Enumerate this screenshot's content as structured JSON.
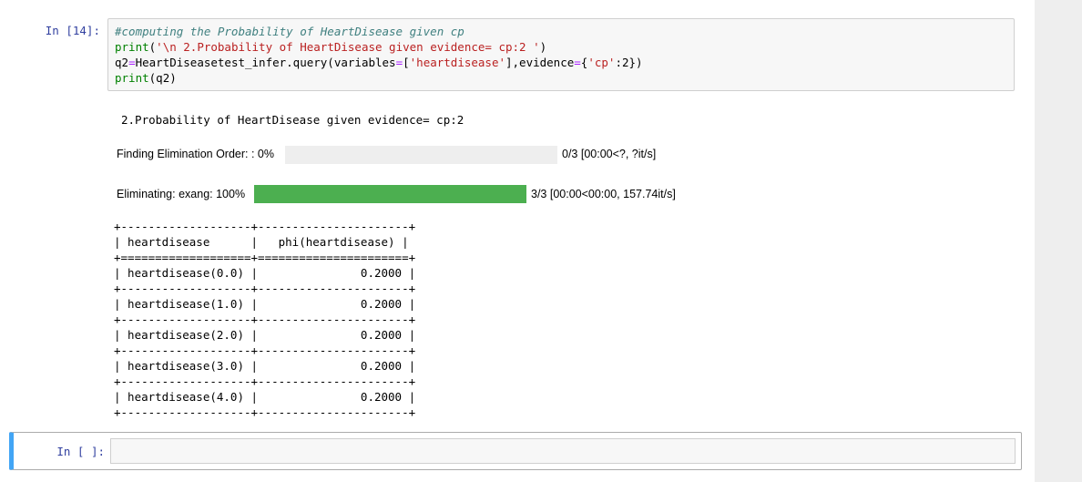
{
  "cell1": {
    "prompt": "In [14]:",
    "code": {
      "line1": "#computing the Probability of HeartDisease given cp",
      "line2_print": "print",
      "line2_open": "(",
      "line2_string": "'\\n 2.Probability of HeartDisease given evidence= cp:2 '",
      "line2_close": ")",
      "line3_a": "q2",
      "line3_eq": "=",
      "line3_b": "HeartDiseasetest_infer.query(variables",
      "line3_eq2": "=",
      "line3_c": "[",
      "line3_str1": "'heartdisease'",
      "line3_d": "],evidence",
      "line3_eq3": "=",
      "line3_e": "{",
      "line3_str2": "'cp'",
      "line3_f": ":2})",
      "line4_print": "print",
      "line4_rest": "(q2)"
    },
    "output": {
      "heading": "2.Probability of HeartDisease given evidence= cp:2",
      "progress1": {
        "label": "Finding Elimination Order: : 0%",
        "status": "0/3 [00:00<?, ?it/s]",
        "fraction": 0.0
      },
      "progress2": {
        "label": "Eliminating: exang: 100%",
        "status": "3/3 [00:00<00:00, 157.74it/s]",
        "fraction": 1.0
      },
      "table": {
        "border": "+-------------------+----------------------+",
        "header_sep": "+===================+======================+",
        "header": "| heartdisease      |   phi(heartdisease) |",
        "rows": [
          "| heartdisease(0.0) |               0.2000 |",
          "| heartdisease(1.0) |               0.2000 |",
          "| heartdisease(2.0) |               0.2000 |",
          "| heartdisease(3.0) |               0.2000 |",
          "| heartdisease(4.0) |               0.2000 |"
        ]
      }
    }
  },
  "cell2": {
    "prompt": "In [ ]:"
  },
  "colors": {
    "progress_fill": "#4caf50",
    "progress_track": "#eeeeee",
    "active_cell_border": "#42a5f5",
    "prompt": "#303f9f"
  }
}
